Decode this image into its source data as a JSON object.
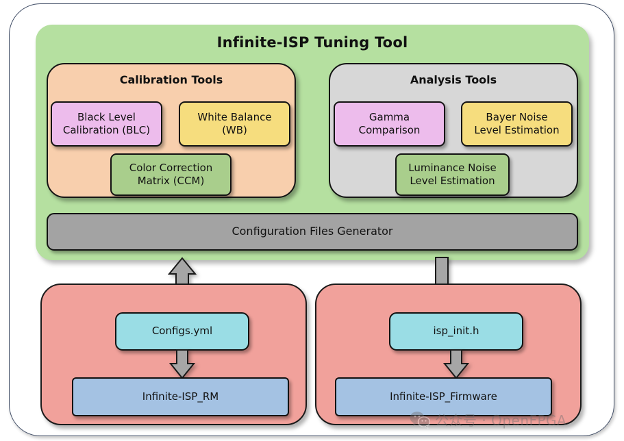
{
  "diagram": {
    "root": {
      "title": "Infinite-ISP Tuning Tool",
      "color": "#b5e0a0"
    },
    "groups": [
      {
        "title": "Calibration Tools",
        "color": "#f8cfad",
        "items": [
          {
            "label": "Black Level Calibration (BLC)",
            "line1": "Black Level",
            "line2": "Calibration (BLC)",
            "color": "#edbcec"
          },
          {
            "label": "White Balance (WB)",
            "line1": "White Balance",
            "line2": "(WB)",
            "color": "#f6dd7e"
          },
          {
            "label": "Color Correction Matrix (CCM)",
            "line1": "Color Correction",
            "line2": "Matrix (CCM)",
            "color": "#a9ce8c"
          }
        ]
      },
      {
        "title": "Analysis Tools",
        "color": "#d7d7d7",
        "items": [
          {
            "label": "Gamma Comparison",
            "line1": "Gamma",
            "line2": "Comparison",
            "color": "#edbcec"
          },
          {
            "label": "Bayer Noise Level Estimation",
            "line1": "Bayer Noise",
            "line2": "Level Estimation",
            "color": "#f6dd7e"
          },
          {
            "label": "Luminance Noise Level Estimation",
            "line1": "Luminance Noise",
            "line2": "Level Estimation",
            "color": "#a9ce8c"
          }
        ]
      }
    ],
    "generator": {
      "label": "Configuration Files Generator",
      "color": "#a3a3a3"
    },
    "outputs": [
      {
        "panel_color": "#f1a19b",
        "file": {
          "label": "Configs.yml",
          "color": "#9adde5"
        },
        "target": {
          "label": "Infinite-ISP_RM",
          "color": "#a4c2e3"
        },
        "connector": "bidirectional-arrow"
      },
      {
        "panel_color": "#f1a19b",
        "file": {
          "label": "isp_init.h",
          "color": "#9adde5"
        },
        "target": {
          "label": "Infinite-ISP_Firmware",
          "color": "#a4c2e3"
        },
        "connector": "down-arrow"
      }
    ],
    "arrow_color": "#a6a6a6",
    "arrow_stroke": "#1a1a1a"
  },
  "watermark": {
    "icon": "wechat-icon",
    "text": "公众号 · OpenFPGA",
    "color": "#6f6f6f"
  }
}
